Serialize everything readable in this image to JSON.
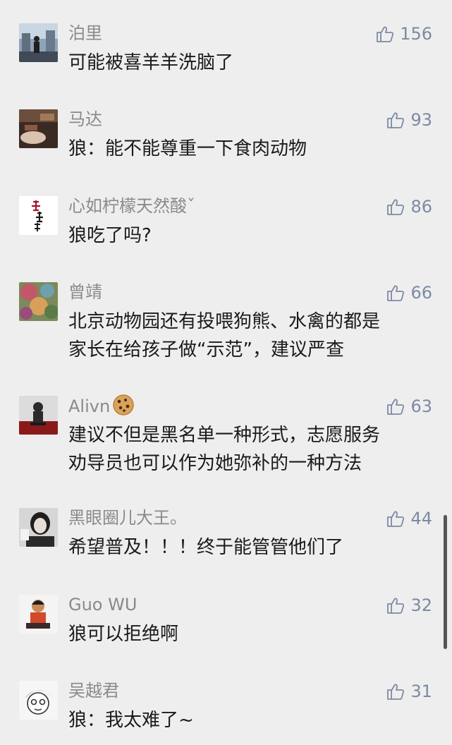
{
  "comments": [
    {
      "name": "泊里",
      "likes": "156",
      "lines": [
        "可能被喜羊羊洗脑了"
      ]
    },
    {
      "name": "马达",
      "likes": "93",
      "lines": [
        "狼：能不能尊重一下食肉动物"
      ]
    },
    {
      "name": "心如柠檬天然酸ˇ",
      "likes": "86",
      "lines": [
        "狼吃了吗?"
      ]
    },
    {
      "name": "曾靖",
      "likes": "66",
      "lines": [
        "北京动物园还有投喂狗熊、水禽的都是",
        "家长在给孩子做“示范”，建议严查"
      ]
    },
    {
      "name": "Alivn",
      "likes": "63",
      "lines": [
        "建议不但是黑名单一种形式，志愿服务",
        "劝导员也可以作为她弥补的一种方法"
      ]
    },
    {
      "name": "黑眼圈儿大王。",
      "likes": "44",
      "lines": [
        "希望普及！！！终于能管管他们了"
      ]
    },
    {
      "name": "Guo WU",
      "likes": "32",
      "lines": [
        "狼可以拒绝啊"
      ]
    },
    {
      "name": "吴越君",
      "likes": "31",
      "lines": [
        "狼：我太难了~"
      ]
    }
  ],
  "icons": {
    "like": "thumbs-up-icon",
    "name_emoji": "cookie-icon"
  },
  "colors": {
    "background": "#eeeeee",
    "name": "#8a8a8a",
    "text": "#1a1a1a",
    "like": "#7d8aa3"
  }
}
